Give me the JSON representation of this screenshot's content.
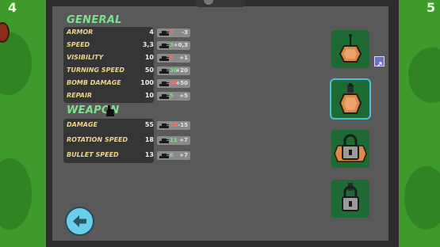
{
  "corners": {
    "left_number": "4",
    "right_number": "5"
  },
  "sections": {
    "general": {
      "title": "GENERAL",
      "stats": [
        {
          "label": "ARMOR",
          "value": "4",
          "current": "7",
          "current_color": "#ff6b6b",
          "delta": "-3"
        },
        {
          "label": "SPEED",
          "value": "3,3",
          "current": "3",
          "current_color": "#7ee08e",
          "delta": "+0,3"
        },
        {
          "label": "VISIBILITY",
          "value": "10",
          "current": "9",
          "current_color": "#ff6b6b",
          "delta": "+1"
        },
        {
          "label": "TURNING SPEED",
          "value": "50",
          "current": "30",
          "current_color": "#7ee08e",
          "delta": "+20"
        },
        {
          "label": "BOMB DAMAGE",
          "value": "100",
          "current": "50",
          "current_color": "#ff6b6b",
          "delta": "+50"
        },
        {
          "label": "REPAIR",
          "value": "10",
          "current": "5",
          "current_color": "#7ee08e",
          "delta": "+5"
        }
      ]
    },
    "weapon": {
      "title": "WEAPON",
      "stats": [
        {
          "label": "DAMAGE",
          "value": "55",
          "current": "70",
          "current_color": "#ff6b6b",
          "delta": "-15"
        },
        {
          "label": "ROTATION SPEED",
          "value": "18",
          "current": "11",
          "current_color": "#7ee08e",
          "delta": "+7"
        },
        {
          "label": "BULLET SPEED",
          "value": "13",
          "current": "6",
          "current_color": "#7ee08e",
          "delta": "+7"
        }
      ]
    }
  },
  "slots": [
    {
      "name": "slot-1",
      "state": "unlocked"
    },
    {
      "name": "slot-2",
      "state": "selected"
    },
    {
      "name": "slot-3",
      "state": "locked"
    },
    {
      "name": "slot-4",
      "state": "locked"
    }
  ],
  "colors": {
    "section_title": "#7ee08e",
    "stat_label": "#f0d58a",
    "slot_bg": "#1d6b33",
    "selected_outline": "#49c2d9",
    "back_button": "#6ccfe9"
  },
  "icons": {
    "weapon": "glove-icon",
    "tank": "tank-silhouette-icon",
    "back": "back-arrow-icon",
    "lock": "padlock-icon",
    "hull": "tank-hull-icon"
  }
}
